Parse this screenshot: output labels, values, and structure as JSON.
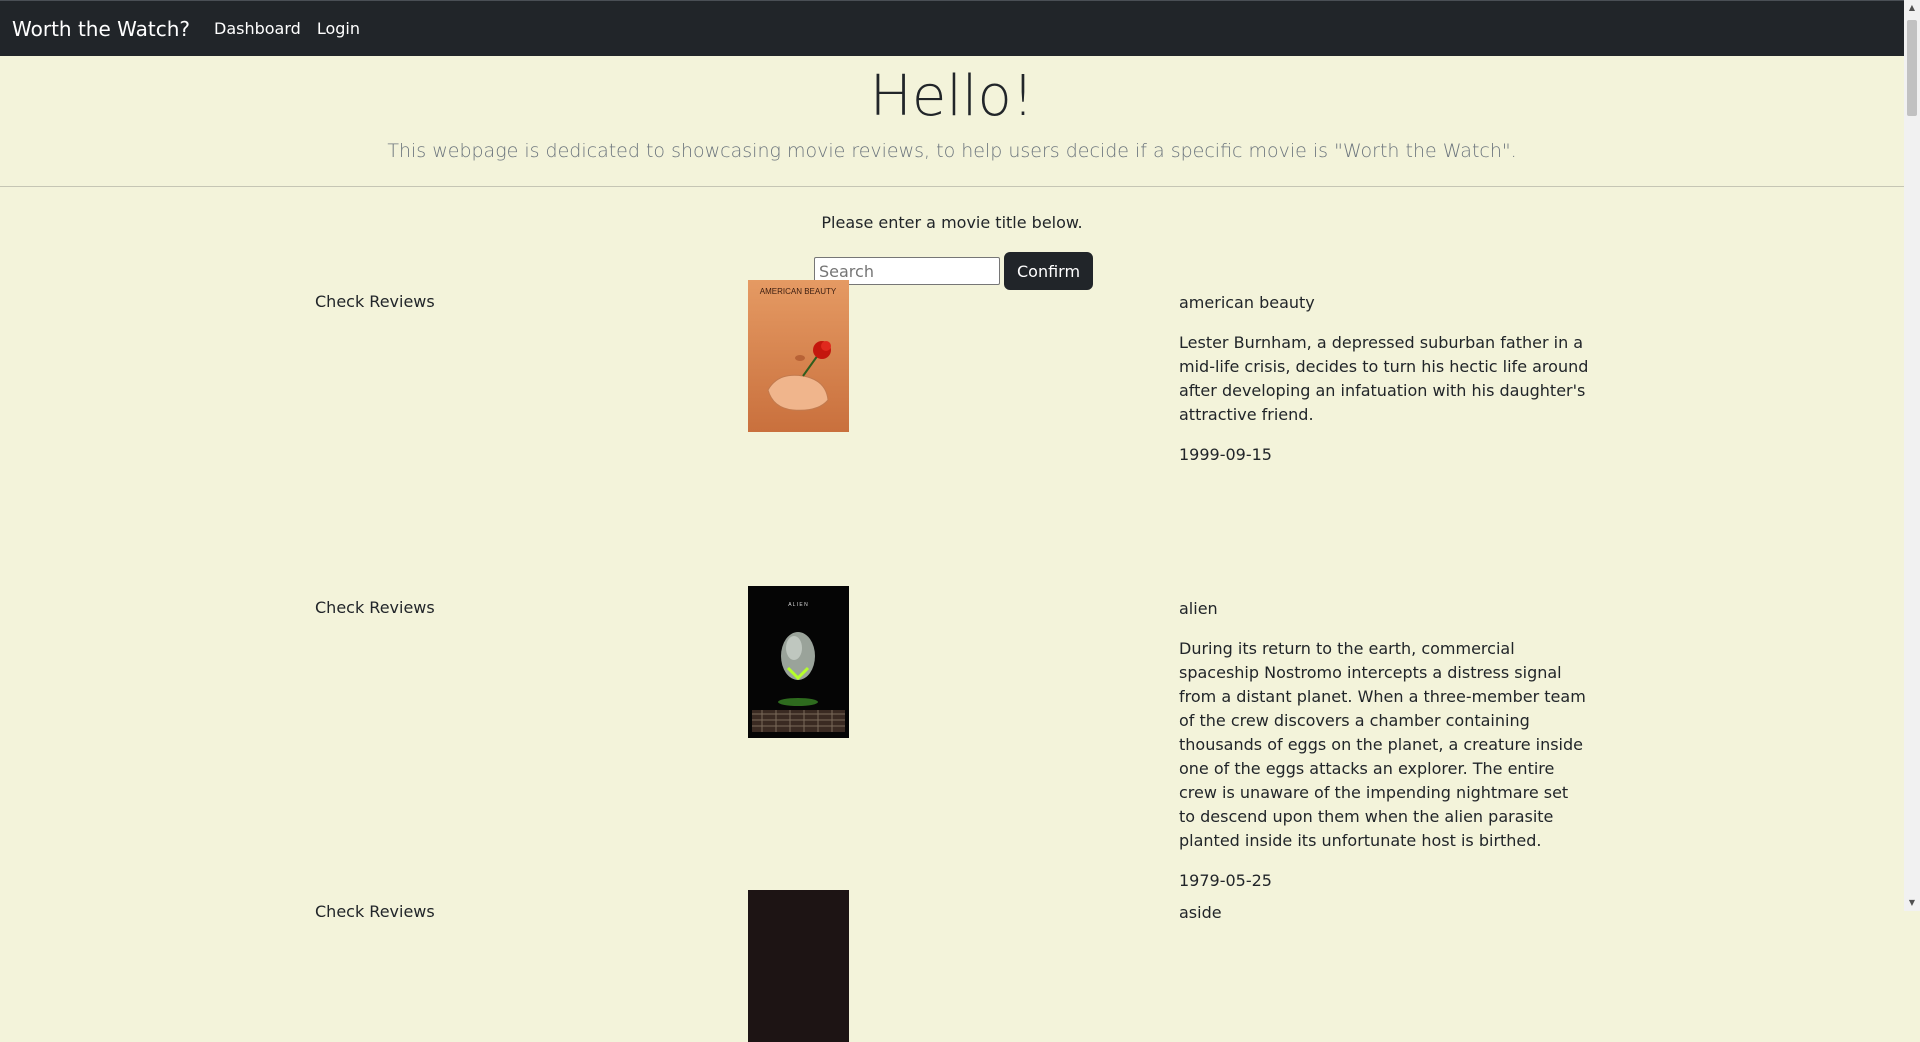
{
  "nav": {
    "brand": "Worth the Watch?",
    "links": [
      "Dashboard",
      "Login"
    ]
  },
  "hero": {
    "heading": "Hello!",
    "lead": "This webpage is dedicated to showcasing movie reviews, to help users decide if a specific movie is \"Worth the Watch\"."
  },
  "search": {
    "prompt": "Please enter a movie title below.",
    "placeholder": "Search",
    "button": "Confirm"
  },
  "movies": [
    {
      "link": "Check Reviews",
      "title": "american beauty",
      "overview": "Lester Burnham, a depressed suburban father in a mid-life crisis, decides to turn his hectic life around after developing an infatuation with his daughter's attractive friend.",
      "date": "1999-09-15",
      "poster_text": "AMERICAN BEAUTY"
    },
    {
      "link": "Check Reviews",
      "title": "alien",
      "overview": "During its return to the earth, commercial spaceship Nostromo intercepts a distress signal from a distant planet. When a three-member team of the crew discovers a chamber containing thousands of eggs on the planet, a creature inside one of the eggs attacks an explorer. The entire crew is unaware of the impending nightmare set to descend upon them when the alien parasite planted inside its unfortunate host is birthed.",
      "date": "1979-05-25",
      "poster_text": "A L I E N"
    },
    {
      "link": "Check Reviews",
      "title": "aside"
    }
  ]
}
